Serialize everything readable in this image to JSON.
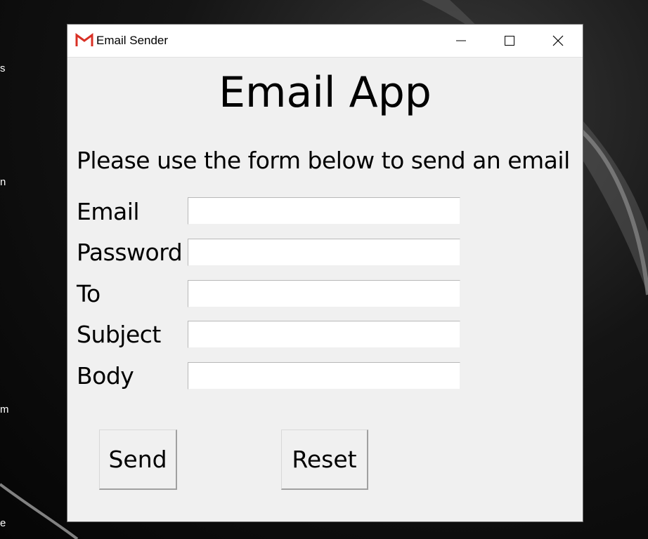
{
  "window": {
    "title": "Email Sender",
    "icon": "gmail-icon",
    "controls": {
      "minimize": "minimize-icon",
      "maximize": "maximize-icon",
      "close": "close-icon"
    }
  },
  "desktop": {
    "edge_labels": [
      "s",
      "n",
      "m",
      "e"
    ]
  },
  "main": {
    "heading": "Email App",
    "subtitle": "Please use the form below to send an email",
    "fields": [
      {
        "label": "Email",
        "value": ""
      },
      {
        "label": "Password",
        "value": ""
      },
      {
        "label": "To",
        "value": ""
      },
      {
        "label": "Subject",
        "value": ""
      },
      {
        "label": "Body",
        "value": ""
      }
    ],
    "buttons": {
      "send": "Send",
      "reset": "Reset"
    }
  },
  "colors": {
    "window_bg": "#f0f0f0",
    "titlebar_bg": "#ffffff",
    "gmail_red": "#d93025",
    "desktop_bg": "#0a0a0a"
  }
}
